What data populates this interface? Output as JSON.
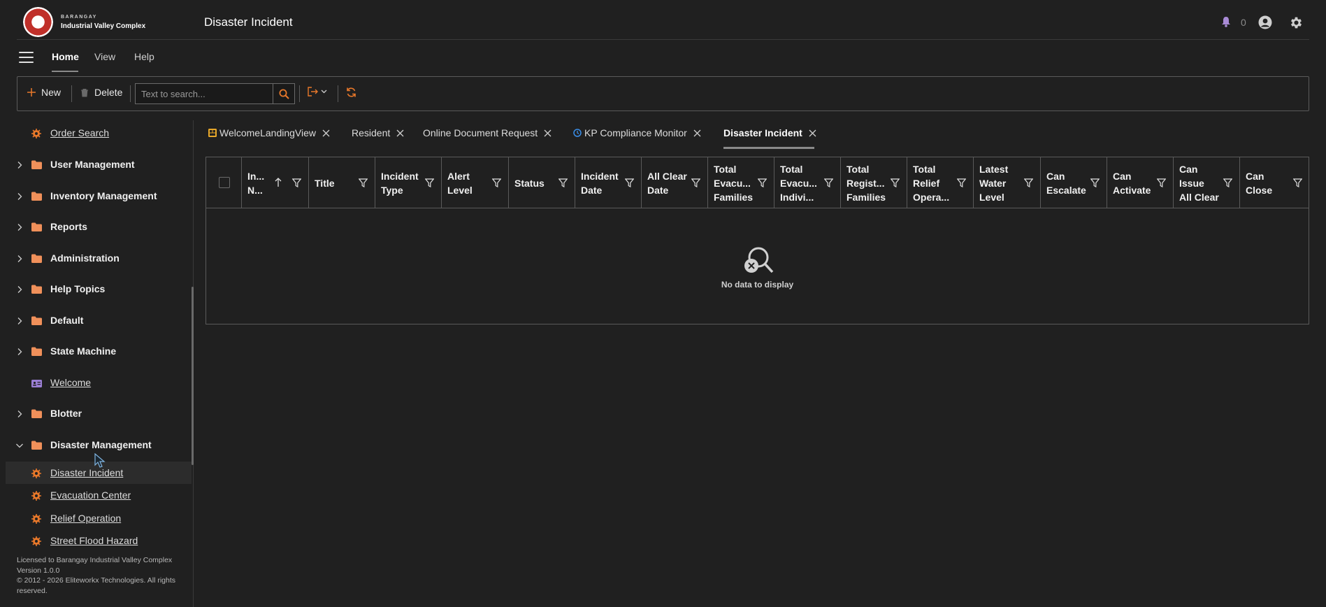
{
  "app": {
    "brand_small": "BARANGAY",
    "brand_name": "Industrial Valley Complex",
    "page_title": "Disaster Incident",
    "notification_count": "0"
  },
  "menu": {
    "tabs": [
      {
        "label": "Home",
        "active": true
      },
      {
        "label": "View"
      },
      {
        "label": "Help"
      }
    ]
  },
  "toolbar": {
    "new_label": "New",
    "delete_label": "Delete",
    "search_placeholder": "Text to search..."
  },
  "sidebar": {
    "items": [
      {
        "label": "Order Search",
        "kind": "link",
        "icon": "gear-icon"
      },
      {
        "label": "User Management",
        "kind": "group",
        "icon": "folder-icon"
      },
      {
        "label": "Inventory Management",
        "kind": "group",
        "icon": "folder-icon"
      },
      {
        "label": "Reports",
        "kind": "group",
        "icon": "folder-icon"
      },
      {
        "label": "Administration",
        "kind": "group",
        "icon": "folder-icon"
      },
      {
        "label": "Help Topics",
        "kind": "group",
        "icon": "folder-icon"
      },
      {
        "label": "Default",
        "kind": "group",
        "icon": "folder-icon"
      },
      {
        "label": "State Machine",
        "kind": "group",
        "icon": "folder-icon"
      },
      {
        "label": "Welcome",
        "kind": "link",
        "icon": "id-card-icon"
      },
      {
        "label": "Blotter",
        "kind": "group",
        "icon": "folder-icon"
      },
      {
        "label": "Disaster Management",
        "kind": "group-open",
        "icon": "folder-icon"
      },
      {
        "label": "Disaster Incident",
        "kind": "link",
        "icon": "gear-icon",
        "selected": true
      },
      {
        "label": "Evacuation Center",
        "kind": "link",
        "icon": "gear-icon"
      },
      {
        "label": "Relief Operation",
        "kind": "link",
        "icon": "gear-icon"
      },
      {
        "label": "Street Flood Hazard",
        "kind": "link",
        "icon": "gear-icon"
      }
    ],
    "footer": {
      "license": "Licensed to Barangay Industrial Valley Complex",
      "version": "Version 1.0.0",
      "copyright": "© 2012 - 2026 Eliteworkx Technologies. All rights reserved."
    }
  },
  "doc_tabs": [
    {
      "label": "WelcomeLandingView",
      "icon": "dashboard-icon"
    },
    {
      "label": "Resident"
    },
    {
      "label": "Online Document Request"
    },
    {
      "label": "KP Compliance Monitor",
      "icon": "clock-icon"
    },
    {
      "label": "Disaster Incident",
      "active": true
    }
  ],
  "grid": {
    "columns": [
      {
        "label": "In... N...",
        "sorted": "asc"
      },
      {
        "label": "Title"
      },
      {
        "label": "Incident Type"
      },
      {
        "label": "Alert Level"
      },
      {
        "label": "Status"
      },
      {
        "label": "Incident Date"
      },
      {
        "label": "All Clear Date"
      },
      {
        "label": "Total Evacu... Families"
      },
      {
        "label": "Total Evacu... Indivi..."
      },
      {
        "label": "Total Regist... Families"
      },
      {
        "label": "Total Relief Opera..."
      },
      {
        "label": "Latest Water Level"
      },
      {
        "label": "Can Escalate"
      },
      {
        "label": "Can Activate"
      },
      {
        "label": "Can Issue All Clear"
      },
      {
        "label": "Can Close"
      }
    ],
    "empty_text": "No data to display"
  },
  "colors": {
    "accent": "#e8782a",
    "background": "#202020",
    "border": "#5a5a5a",
    "welcome_icon": "#9b7fd4",
    "notification": "#a98bd6"
  }
}
